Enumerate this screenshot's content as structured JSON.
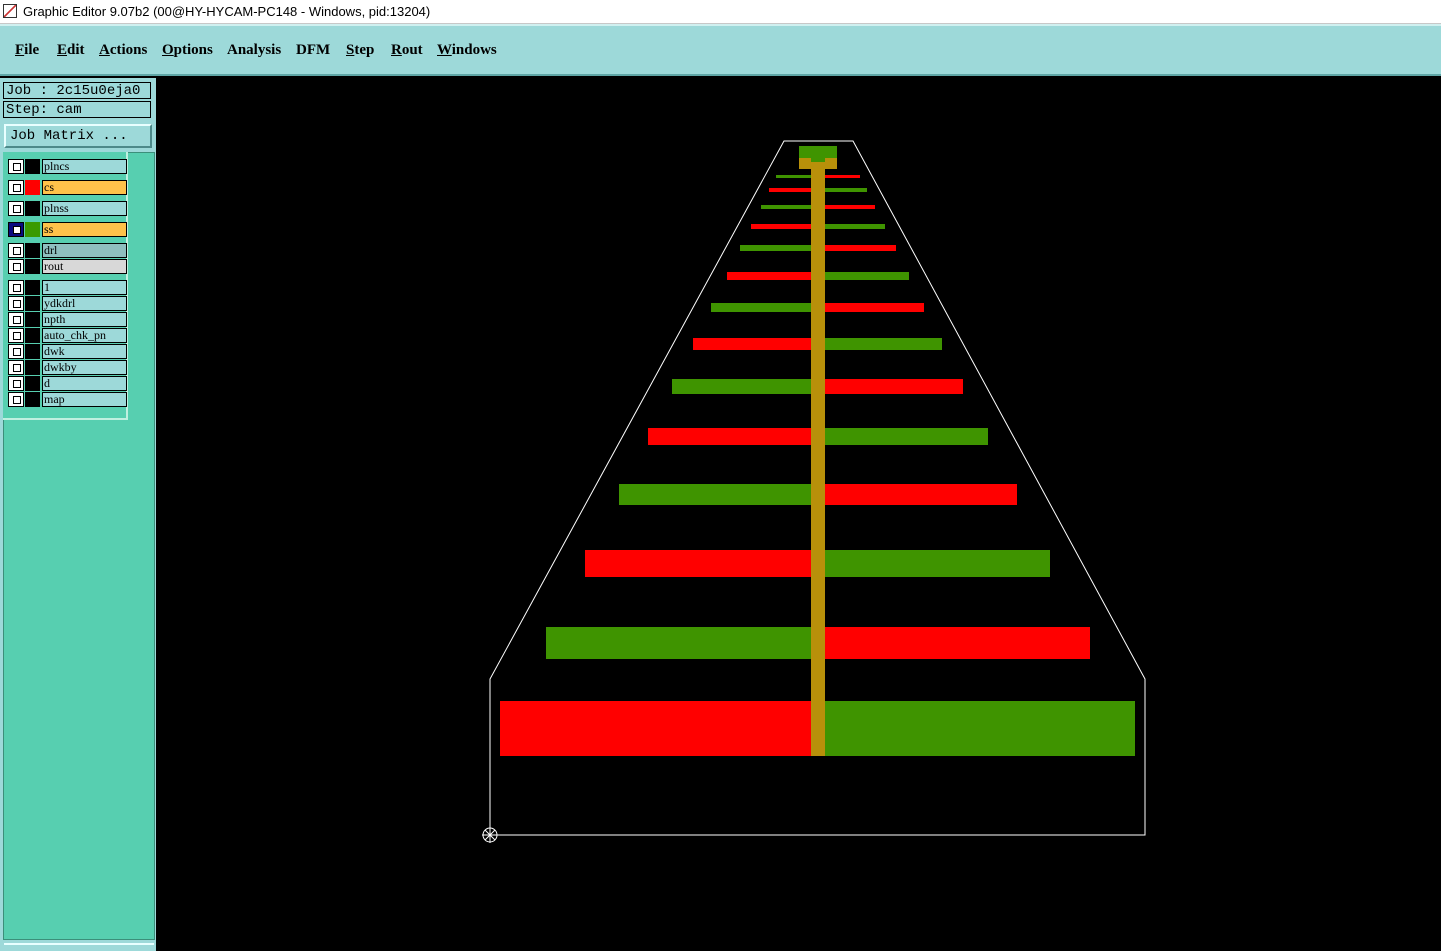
{
  "window": {
    "title": "Graphic Editor 9.07b2 (00@HY-HYCAM-PC148 - Windows, pid:13204)"
  },
  "menubar": {
    "items": [
      {
        "label": "File",
        "ul": "F",
        "rest": "ile"
      },
      {
        "label": "Edit",
        "ul": "E",
        "rest": "dit"
      },
      {
        "label": "Actions",
        "ul": "A",
        "rest": "ctions"
      },
      {
        "label": "Options",
        "ul": "O",
        "rest": "ptions"
      },
      {
        "label": "Analysis",
        "ul": "",
        "rest": "Analysis"
      },
      {
        "label": "DFM",
        "ul": "",
        "rest": "DFM"
      },
      {
        "label": "Step",
        "ul": "S",
        "rest": "tep"
      },
      {
        "label": "Rout",
        "ul": "R",
        "rest": "out"
      },
      {
        "label": "Windows",
        "ul": "W",
        "rest": "indows"
      }
    ]
  },
  "job": {
    "job_text": "Job : 2c15u0eja0",
    "step_text": "Step: cam",
    "matrix_button": "Job Matrix ..."
  },
  "layers": [
    {
      "name": "plncs",
      "swatch": "#000000",
      "style": "normal"
    },
    {
      "name": "cs",
      "swatch": "#ff0000",
      "style": "active"
    },
    {
      "name": "plnss",
      "swatch": "#000000",
      "style": "normal"
    },
    {
      "name": "ss",
      "swatch": "#3a9a00",
      "style": "active"
    },
    {
      "name": "drl",
      "swatch": "#000000",
      "style": "drill"
    },
    {
      "name": "rout",
      "swatch": "#000000",
      "style": "rout"
    },
    {
      "name": "1",
      "swatch": "#000000",
      "style": "normal"
    },
    {
      "name": "ydkdrl",
      "swatch": "#000000",
      "style": "normal"
    },
    {
      "name": "npth",
      "swatch": "#000000",
      "style": "normal"
    },
    {
      "name": "auto_chk_pn",
      "swatch": "#000000",
      "style": "normal"
    },
    {
      "name": "dwk",
      "swatch": "#000000",
      "style": "normal"
    },
    {
      "name": "dwkby",
      "swatch": "#000000",
      "style": "normal"
    },
    {
      "name": "d",
      "swatch": "#000000",
      "style": "normal"
    },
    {
      "name": "map",
      "swatch": "#000000",
      "style": "normal"
    }
  ],
  "colors": {
    "cs_layer": "#ff0000",
    "ss_layer": "#3f9400",
    "spine": "#b8900a",
    "outline": "#ffffff",
    "background": "#000000"
  },
  "icons": {
    "origin_marker": "crosshair-origin-icon"
  }
}
